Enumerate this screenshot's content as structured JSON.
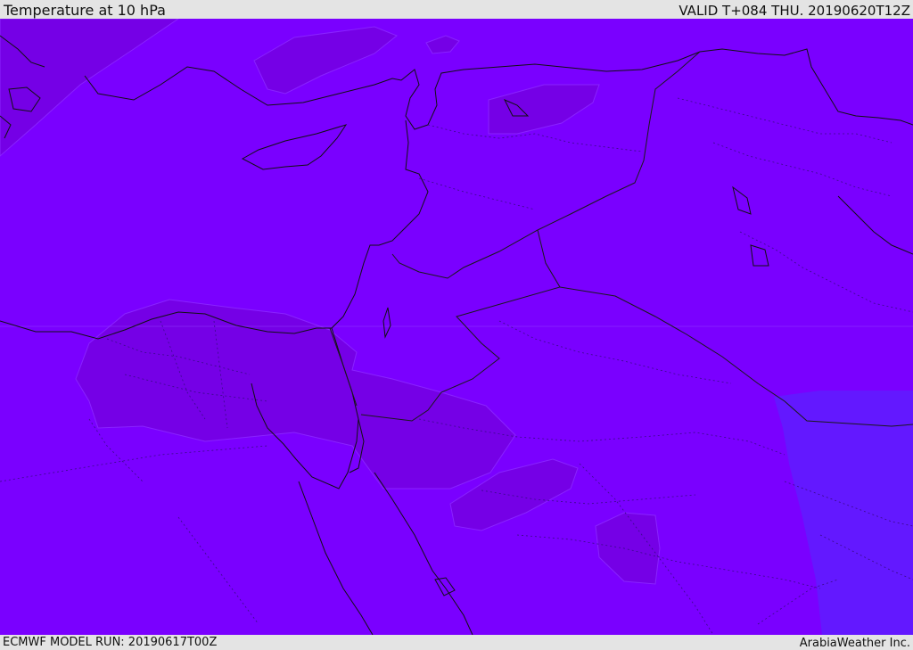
{
  "header": {
    "title": "Temperature at 10 hPa",
    "valid_time": "VALID T+084 THU. 20190620T12Z"
  },
  "footer": {
    "model_run": "ECMWF MODEL RUN: 20190617T00Z",
    "credit": "ArabiaWeather Inc."
  },
  "map": {
    "field": "temperature",
    "pressure_level": "10 hPa",
    "colors": {
      "base_field": "#7a00ff",
      "cooler_patch": "#7500e6",
      "warmer_patch": "#6318ff",
      "coastline": "#111111",
      "border": "#222222"
    }
  }
}
